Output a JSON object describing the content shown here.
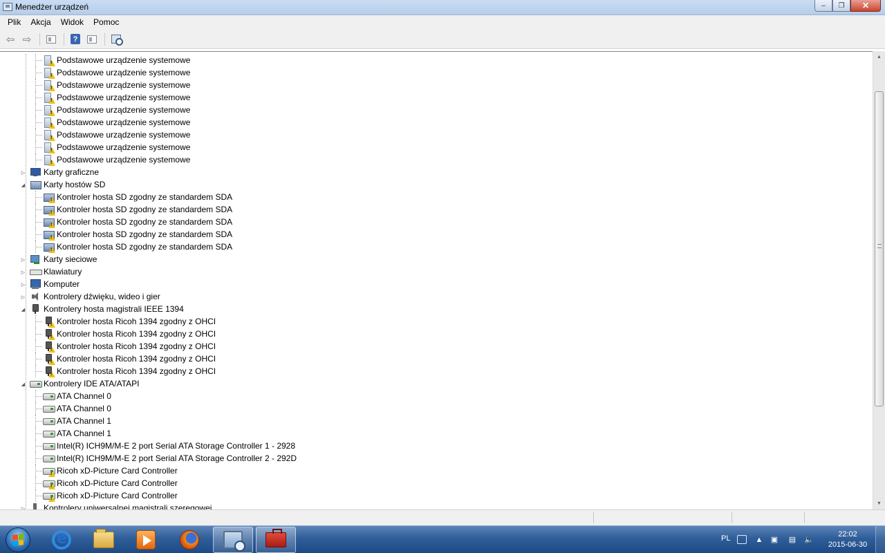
{
  "window": {
    "title": "Menedżer urządzeń",
    "controls": {
      "minimize": "–",
      "maximize": "❐",
      "close": "✕"
    }
  },
  "menu": [
    "Plik",
    "Akcja",
    "Widok",
    "Pomoc"
  ],
  "toolbar": {
    "buttons": [
      "back-arrow-icon",
      "forward-arrow-icon",
      "properties-pane-icon",
      "help-icon",
      "view-pane-icon",
      "scan-hardware-icon"
    ]
  },
  "tree": {
    "rows": [
      {
        "label": "Podstawowe urządzenie systemowe",
        "level": 2,
        "icon": "system-device-icon",
        "warning": true
      },
      {
        "label": "Podstawowe urządzenie systemowe",
        "level": 2,
        "icon": "system-device-icon",
        "warning": true
      },
      {
        "label": "Podstawowe urządzenie systemowe",
        "level": 2,
        "icon": "system-device-icon",
        "warning": true
      },
      {
        "label": "Podstawowe urządzenie systemowe",
        "level": 2,
        "icon": "system-device-icon",
        "warning": true
      },
      {
        "label": "Podstawowe urządzenie systemowe",
        "level": 2,
        "icon": "system-device-icon",
        "warning": true
      },
      {
        "label": "Podstawowe urządzenie systemowe",
        "level": 2,
        "icon": "system-device-icon",
        "warning": true
      },
      {
        "label": "Podstawowe urządzenie systemowe",
        "level": 2,
        "icon": "system-device-icon",
        "warning": true
      },
      {
        "label": "Podstawowe urządzenie systemowe",
        "level": 2,
        "icon": "system-device-icon",
        "warning": true
      },
      {
        "label": "Podstawowe urządzenie systemowe",
        "level": 2,
        "icon": "system-device-icon",
        "warning": true
      },
      {
        "label": "Karty graficzne",
        "level": 1,
        "icon": "display-adapter-icon",
        "expander": "collapsed"
      },
      {
        "label": "Karty hostów SD",
        "level": 1,
        "icon": "sd-host-icon",
        "expander": "expanded"
      },
      {
        "label": "Kontroler hosta SD zgodny ze standardem SDA",
        "level": 2,
        "icon": "sd-host-icon",
        "warning": true
      },
      {
        "label": "Kontroler hosta SD zgodny ze standardem SDA",
        "level": 2,
        "icon": "sd-host-icon",
        "warning": true
      },
      {
        "label": "Kontroler hosta SD zgodny ze standardem SDA",
        "level": 2,
        "icon": "sd-host-icon",
        "warning": true
      },
      {
        "label": "Kontroler hosta SD zgodny ze standardem SDA",
        "level": 2,
        "icon": "sd-host-icon",
        "warning": true
      },
      {
        "label": "Kontroler hosta SD zgodny ze standardem SDA",
        "level": 2,
        "icon": "sd-host-icon",
        "warning": true
      },
      {
        "label": "Karty sieciowe",
        "level": 1,
        "icon": "network-adapter-icon",
        "expander": "collapsed"
      },
      {
        "label": "Klawiatury",
        "level": 1,
        "icon": "keyboard-icon",
        "expander": "collapsed"
      },
      {
        "label": "Komputer",
        "level": 1,
        "icon": "computer-icon",
        "expander": "collapsed"
      },
      {
        "label": "Kontrolery dźwięku, wideo i gier",
        "level": 1,
        "icon": "sound-icon",
        "expander": "collapsed"
      },
      {
        "label": "Kontrolery hosta magistrali IEEE 1394",
        "level": 1,
        "icon": "ieee1394-icon",
        "expander": "expanded"
      },
      {
        "label": "Kontroler hosta Ricoh 1394 zgodny z OHCI",
        "level": 2,
        "icon": "ieee1394-icon",
        "warning": true
      },
      {
        "label": "Kontroler hosta Ricoh 1394 zgodny z OHCI",
        "level": 2,
        "icon": "ieee1394-icon",
        "warning": true
      },
      {
        "label": "Kontroler hosta Ricoh 1394 zgodny z OHCI",
        "level": 2,
        "icon": "ieee1394-icon",
        "warning": true
      },
      {
        "label": "Kontroler hosta Ricoh 1394 zgodny z OHCI",
        "level": 2,
        "icon": "ieee1394-icon",
        "warning": true
      },
      {
        "label": "Kontroler hosta Ricoh 1394 zgodny z OHCI",
        "level": 2,
        "icon": "ieee1394-icon",
        "warning": true
      },
      {
        "label": "Kontrolery IDE ATA/ATAPI",
        "level": 1,
        "icon": "ide-controller-icon",
        "expander": "expanded"
      },
      {
        "label": "ATA Channel 0",
        "level": 2,
        "icon": "ide-controller-icon",
        "warning": false
      },
      {
        "label": "ATA Channel 0",
        "level": 2,
        "icon": "ide-controller-icon",
        "warning": false
      },
      {
        "label": "ATA Channel 1",
        "level": 2,
        "icon": "ide-controller-icon",
        "warning": false
      },
      {
        "label": "ATA Channel 1",
        "level": 2,
        "icon": "ide-controller-icon",
        "warning": false
      },
      {
        "label": "Intel(R) ICH9M/M-E 2 port Serial ATA Storage Controller 1 - 2928",
        "level": 2,
        "icon": "ide-controller-icon",
        "warning": false
      },
      {
        "label": "Intel(R) ICH9M/M-E 2 port Serial ATA Storage Controller 2 - 292D",
        "level": 2,
        "icon": "ide-controller-icon",
        "warning": false
      },
      {
        "label": "Ricoh xD-Picture Card Controller",
        "level": 2,
        "icon": "ide-controller-icon",
        "warning": true
      },
      {
        "label": "Ricoh xD-Picture Card Controller",
        "level": 2,
        "icon": "ide-controller-icon",
        "warning": true
      },
      {
        "label": "Ricoh xD-Picture Card Controller",
        "level": 2,
        "icon": "ide-controller-icon",
        "warning": true
      },
      {
        "label": "Kontrolery uniwersalnej magistrali szeregowej",
        "level": 1,
        "icon": "usb-controller-icon",
        "expander": "collapsed"
      }
    ]
  },
  "taskbar": {
    "apps": [
      {
        "name": "internet-explorer-icon",
        "active": false
      },
      {
        "name": "windows-explorer-icon",
        "active": false
      },
      {
        "name": "media-player-icon",
        "active": false
      },
      {
        "name": "firefox-icon",
        "active": false
      },
      {
        "name": "device-manager-icon",
        "active": true
      },
      {
        "name": "toolbox-icon",
        "active": true
      }
    ],
    "language": "PL",
    "time": "22:02",
    "date": "2015-06-30"
  }
}
